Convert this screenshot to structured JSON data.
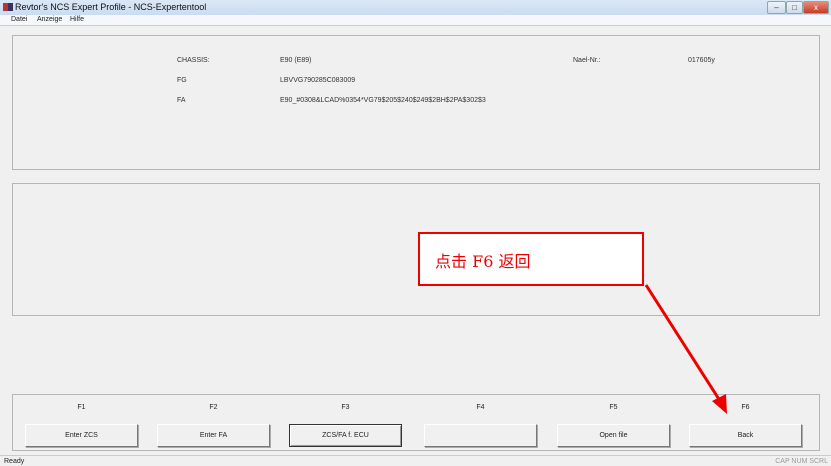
{
  "window": {
    "title": "Revtor's NCS Expert Profile - NCS-Expertentool",
    "minimize": "–",
    "maximize": "□",
    "close": "x"
  },
  "menu": [
    "Datei",
    "Anzeige",
    "Hilfe"
  ],
  "info": {
    "chassis_label": "CHASSIS:",
    "chassis_value": "E90 (E89)",
    "fg_label": "FG",
    "fg_value": "LBVVG790285C083009",
    "fa_label": "FA",
    "fa_value": "E90_#0308&LCAD%0354*VG79$205$240$249$2BH$2PA$302$3",
    "nael_label": "Nael-Nr.:",
    "nael_value": "017605y"
  },
  "fkeys": [
    {
      "key": "F1",
      "label": "Enter ZCS"
    },
    {
      "key": "F2",
      "label": "Enter FA"
    },
    {
      "key": "F3",
      "label": "ZCS/FA f. ECU"
    },
    {
      "key": "F4",
      "label": ""
    },
    {
      "key": "F5",
      "label": "Open file"
    },
    {
      "key": "F6",
      "label": "Back"
    }
  ],
  "status": {
    "left": "Ready",
    "right": "CAP NUM SCRL"
  },
  "annotation": {
    "text": "点击 F6 返回",
    "color": "#e00000"
  }
}
